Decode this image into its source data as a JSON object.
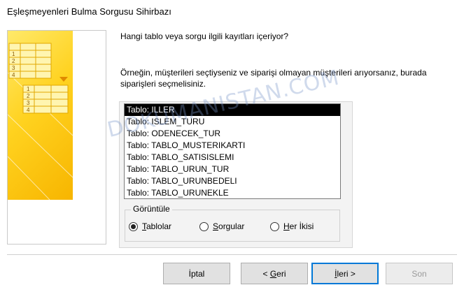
{
  "window": {
    "title": "Eşleşmeyenleri Bulma Sorgusu Sihirbazı"
  },
  "main": {
    "prompt": "Hangi tablo veya sorgu ilgili kayıtları içeriyor?",
    "explanation": "Örneğin, müşterileri seçtiyseniz ve siparişi olmayan müşterileri arıyorsanız, burada siparişleri seçmelisiniz."
  },
  "list": {
    "items": [
      "Tablo: ILLER",
      "Tablo: ISLEM_TURU",
      "Tablo: ODENECEK_TUR",
      "Tablo: TABLO_MUSTERIKARTI",
      "Tablo: TABLO_SATISISLEMI",
      "Tablo: TABLO_URUN_TUR",
      "Tablo: TABLO_URUNBEDELI",
      "Tablo: TABLO_URUNEKLE"
    ],
    "selected_index": 0
  },
  "view_group": {
    "legend": "Görüntüle",
    "options": [
      {
        "mnemonic": "T",
        "rest": "ablolar",
        "checked": true
      },
      {
        "mnemonic": "S",
        "rest": "orgular",
        "checked": false
      },
      {
        "mnemonic": "H",
        "rest": "er İkisi",
        "checked": false
      }
    ]
  },
  "buttons": {
    "cancel": "İptal",
    "back_prefix": "< ",
    "back_mnemonic": "G",
    "back_rest": "eri",
    "next_mnemonic": "İ",
    "next_rest": "leri >",
    "finish": "Son"
  },
  "watermark": "DOKUMANISTAN.COM",
  "illustration": {
    "row_numbers_back": [
      "1",
      "2",
      "3",
      "4"
    ],
    "row_numbers_front": [
      "1",
      "2",
      "3",
      "4"
    ]
  }
}
